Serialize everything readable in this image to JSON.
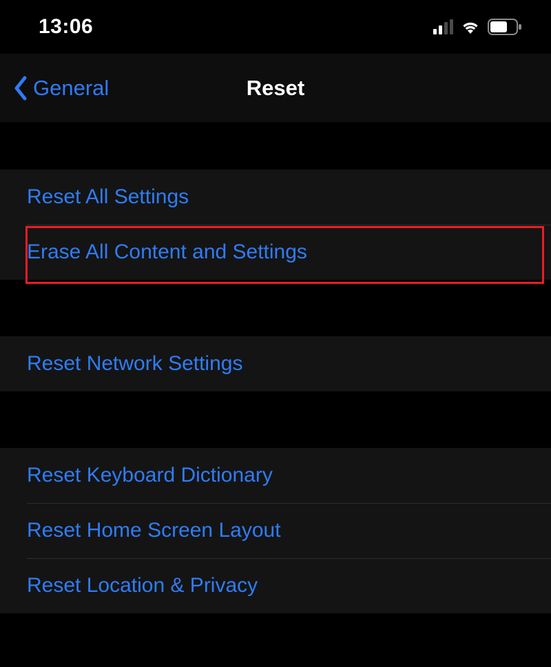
{
  "statusBar": {
    "time": "13:06"
  },
  "nav": {
    "back": "General",
    "title": "Reset"
  },
  "groups": {
    "g1": {
      "r1": "Reset All Settings",
      "r2": "Erase All Content and Settings"
    },
    "g2": {
      "r1": "Reset Network Settings"
    },
    "g3": {
      "r1": "Reset Keyboard Dictionary",
      "r2": "Reset Home Screen Layout",
      "r3": "Reset Location & Privacy"
    }
  }
}
